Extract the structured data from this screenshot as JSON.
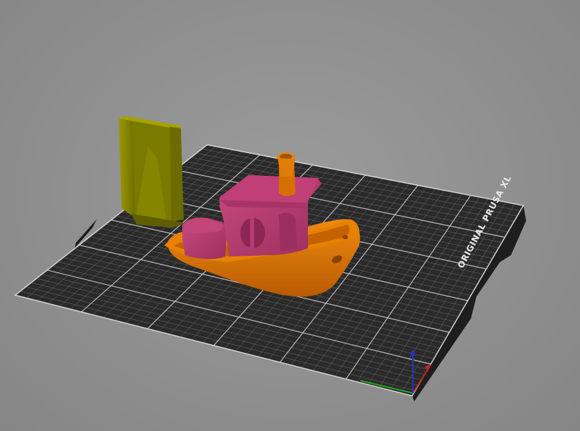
{
  "viewport": {
    "background": "#8f8f8f"
  },
  "bed": {
    "label": "ORIGINAL PRUSA XL",
    "surface_color": "#2c2c2c",
    "grid_color": "#a8a8a8",
    "border_color": "#e0e0e0"
  },
  "objects": [
    {
      "name": "wipe-tower",
      "color": "#8b8a00"
    },
    {
      "name": "benchy-cabin",
      "color": "#b23a6c"
    },
    {
      "name": "benchy-hull",
      "color": "#d97100"
    },
    {
      "name": "benchy-chimney",
      "color": "#d97100"
    }
  ],
  "axes": {
    "x_color": "#cc2222",
    "y_color": "#22aa22",
    "z_color": "#2222cc"
  }
}
